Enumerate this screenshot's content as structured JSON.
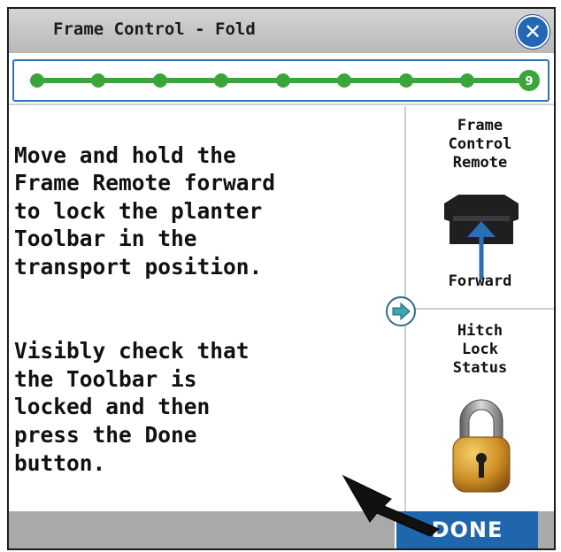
{
  "window": {
    "title": "Frame Control - Fold",
    "close_icon": "close-x-icon"
  },
  "progress": {
    "total_steps": 9,
    "current_step": 9,
    "current_step_label": "9",
    "color": "#3aa63a"
  },
  "instructions": {
    "paragraph_1": "Move and hold the\nFrame Remote forward\nto lock the planter\nToolbar in the\ntransport position.",
    "paragraph_2": "Visibly check that\nthe Toolbar is\nlocked and then\npress the Done\nbutton."
  },
  "side_panel": {
    "remote": {
      "title": "Frame\nControl\nRemote",
      "icon": "frame-remote-icon",
      "direction_label": "Forward"
    },
    "hitch": {
      "title": "Hitch\nLock\nStatus",
      "icon": "padlock-locked-icon"
    },
    "next_icon": "arrow-right-icon"
  },
  "footer": {
    "done_label": "DONE",
    "accent": "#1f66ad"
  }
}
